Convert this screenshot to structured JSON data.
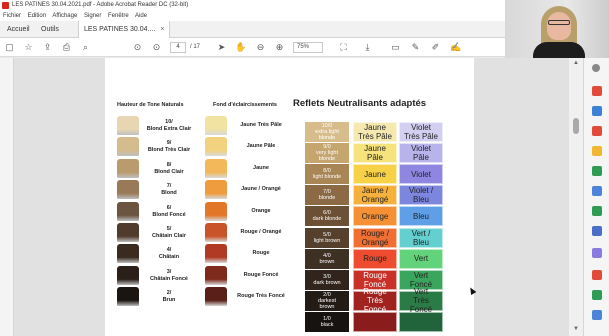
{
  "window": {
    "title": "LES PATINES 30.04.2021.pdf - Adobe Acrobat Reader DC (32-bit)"
  },
  "menu": [
    "Fichier",
    "Edition",
    "Affichage",
    "Signer",
    "Fenêtre",
    "Aide"
  ],
  "tabs": [
    {
      "label": "Accueil"
    },
    {
      "label": "Outils"
    },
    {
      "label": "LES PATINES 30.04....",
      "close": "×"
    }
  ],
  "toolbar": {
    "page_current": "4",
    "page_total": "/ 17",
    "zoom": "75%"
  },
  "document": {
    "col_left_header": "Hauteur de Tone Naturals",
    "col_mid_header": "Fond d'éclaircissements",
    "chart_title": "Reflets Neutralisants adaptés",
    "left_levels": [
      {
        "label": "10/\nBlond Extra Clair",
        "color": "#e7d6b1"
      },
      {
        "label": "9/\nBlond Très Clair",
        "color": "#d5bc8d"
      },
      {
        "label": "8/\nBlond Clair",
        "color": "#b99b6e"
      },
      {
        "label": "7/\nBlond",
        "color": "#987a58"
      },
      {
        "label": "6/\nBlond Foncé",
        "color": "#6b5540"
      },
      {
        "label": "5/\nChâtain Clair",
        "color": "#4f3c2d"
      },
      {
        "label": "4/\nChâtain",
        "color": "#3a2a20"
      },
      {
        "label": "3/\nChâtain Foncé",
        "color": "#2a1f19"
      },
      {
        "label": "2/\nBrun",
        "color": "#1b1512"
      }
    ],
    "mid_levels": [
      {
        "label": "Jaune Très Pâle",
        "color": "#f1e3a2"
      },
      {
        "label": "Jaune Pâle",
        "color": "#f2d27f"
      },
      {
        "label": "Jaune",
        "color": "#f2b85a"
      },
      {
        "label": "Jaune / Orangé",
        "color": "#ee9c3d"
      },
      {
        "label": "Orange",
        "color": "#e2772a"
      },
      {
        "label": "Rouge / Orangé",
        "color": "#c9542a"
      },
      {
        "label": "Rouge",
        "color": "#b03a24"
      },
      {
        "label": "Rouge Foncé",
        "color": "#7e2a1d"
      },
      {
        "label": "Rouge Très Foncé",
        "color": "#5a1f18"
      }
    ],
    "table_rows": [
      {
        "std": "10/0\nextra light\nblonde",
        "std_color": "#d7bd8b",
        "a": "Jaune\nTrès Pâle",
        "a_color": "#f5e9b0",
        "b": "Violet\nTrès Pâle",
        "b_color": "#d3cff0"
      },
      {
        "std": "9/0\nvery light\nblonde",
        "std_color": "#c5a66f",
        "a": "Jaune\nPâle",
        "a_color": "#f7e37b",
        "b": "Violet\nPâle",
        "b_color": "#b9b3ec"
      },
      {
        "std": "8/0\nlight blonde",
        "std_color": "#a98656",
        "a": "Jaune",
        "a_color": "#f7d247",
        "b": "Violet",
        "b_color": "#8f86e2"
      },
      {
        "std": "7/0\nblonde",
        "std_color": "#8b6a45",
        "a": "Jaune /\nOrangé",
        "a_color": "#f6b13c",
        "b": "Violet /\nBleu",
        "b_color": "#7d86df"
      },
      {
        "std": "6/0\ndark blonde",
        "std_color": "#6b5036",
        "a": "Orange",
        "a_color": "#f59134",
        "b": "Bleu",
        "b_color": "#5f9fe8"
      },
      {
        "std": "5/0\nlight brown",
        "std_color": "#54402d",
        "a": "Rouge /\nOrangé",
        "a_color": "#f26f33",
        "b": "Vert /\nBleu",
        "b_color": "#63d0cf"
      },
      {
        "std": "4/0\nbrown",
        "std_color": "#3f3024",
        "a": "Rouge",
        "a_color": "#ee4b2f",
        "b": "Vert",
        "b_color": "#62d37a"
      },
      {
        "std": "3/0\ndark brown",
        "std_color": "#30241d",
        "a": "Rouge\nFoncé",
        "a_color": "#c93028",
        "b": "Vert\nFoncé",
        "b_color": "#3aa55c"
      },
      {
        "std": "2/0\ndarkest\nbrown",
        "std_color": "#231b16",
        "a": "Rouge\nTrès\nFoncé",
        "a_color": "#a12320",
        "b": "Vert\nTrès\nFoncé",
        "b_color": "#2a7b45"
      },
      {
        "std": "1/0\nblack",
        "std_color": "#171310",
        "a": "",
        "a_color": "#8a1d1b",
        "b": "",
        "b_color": "#21633a"
      }
    ]
  },
  "colors": {
    "accent": "#1473e6",
    "page_bg": "#ffffff",
    "viewer_bg": "#e1e1e1"
  }
}
